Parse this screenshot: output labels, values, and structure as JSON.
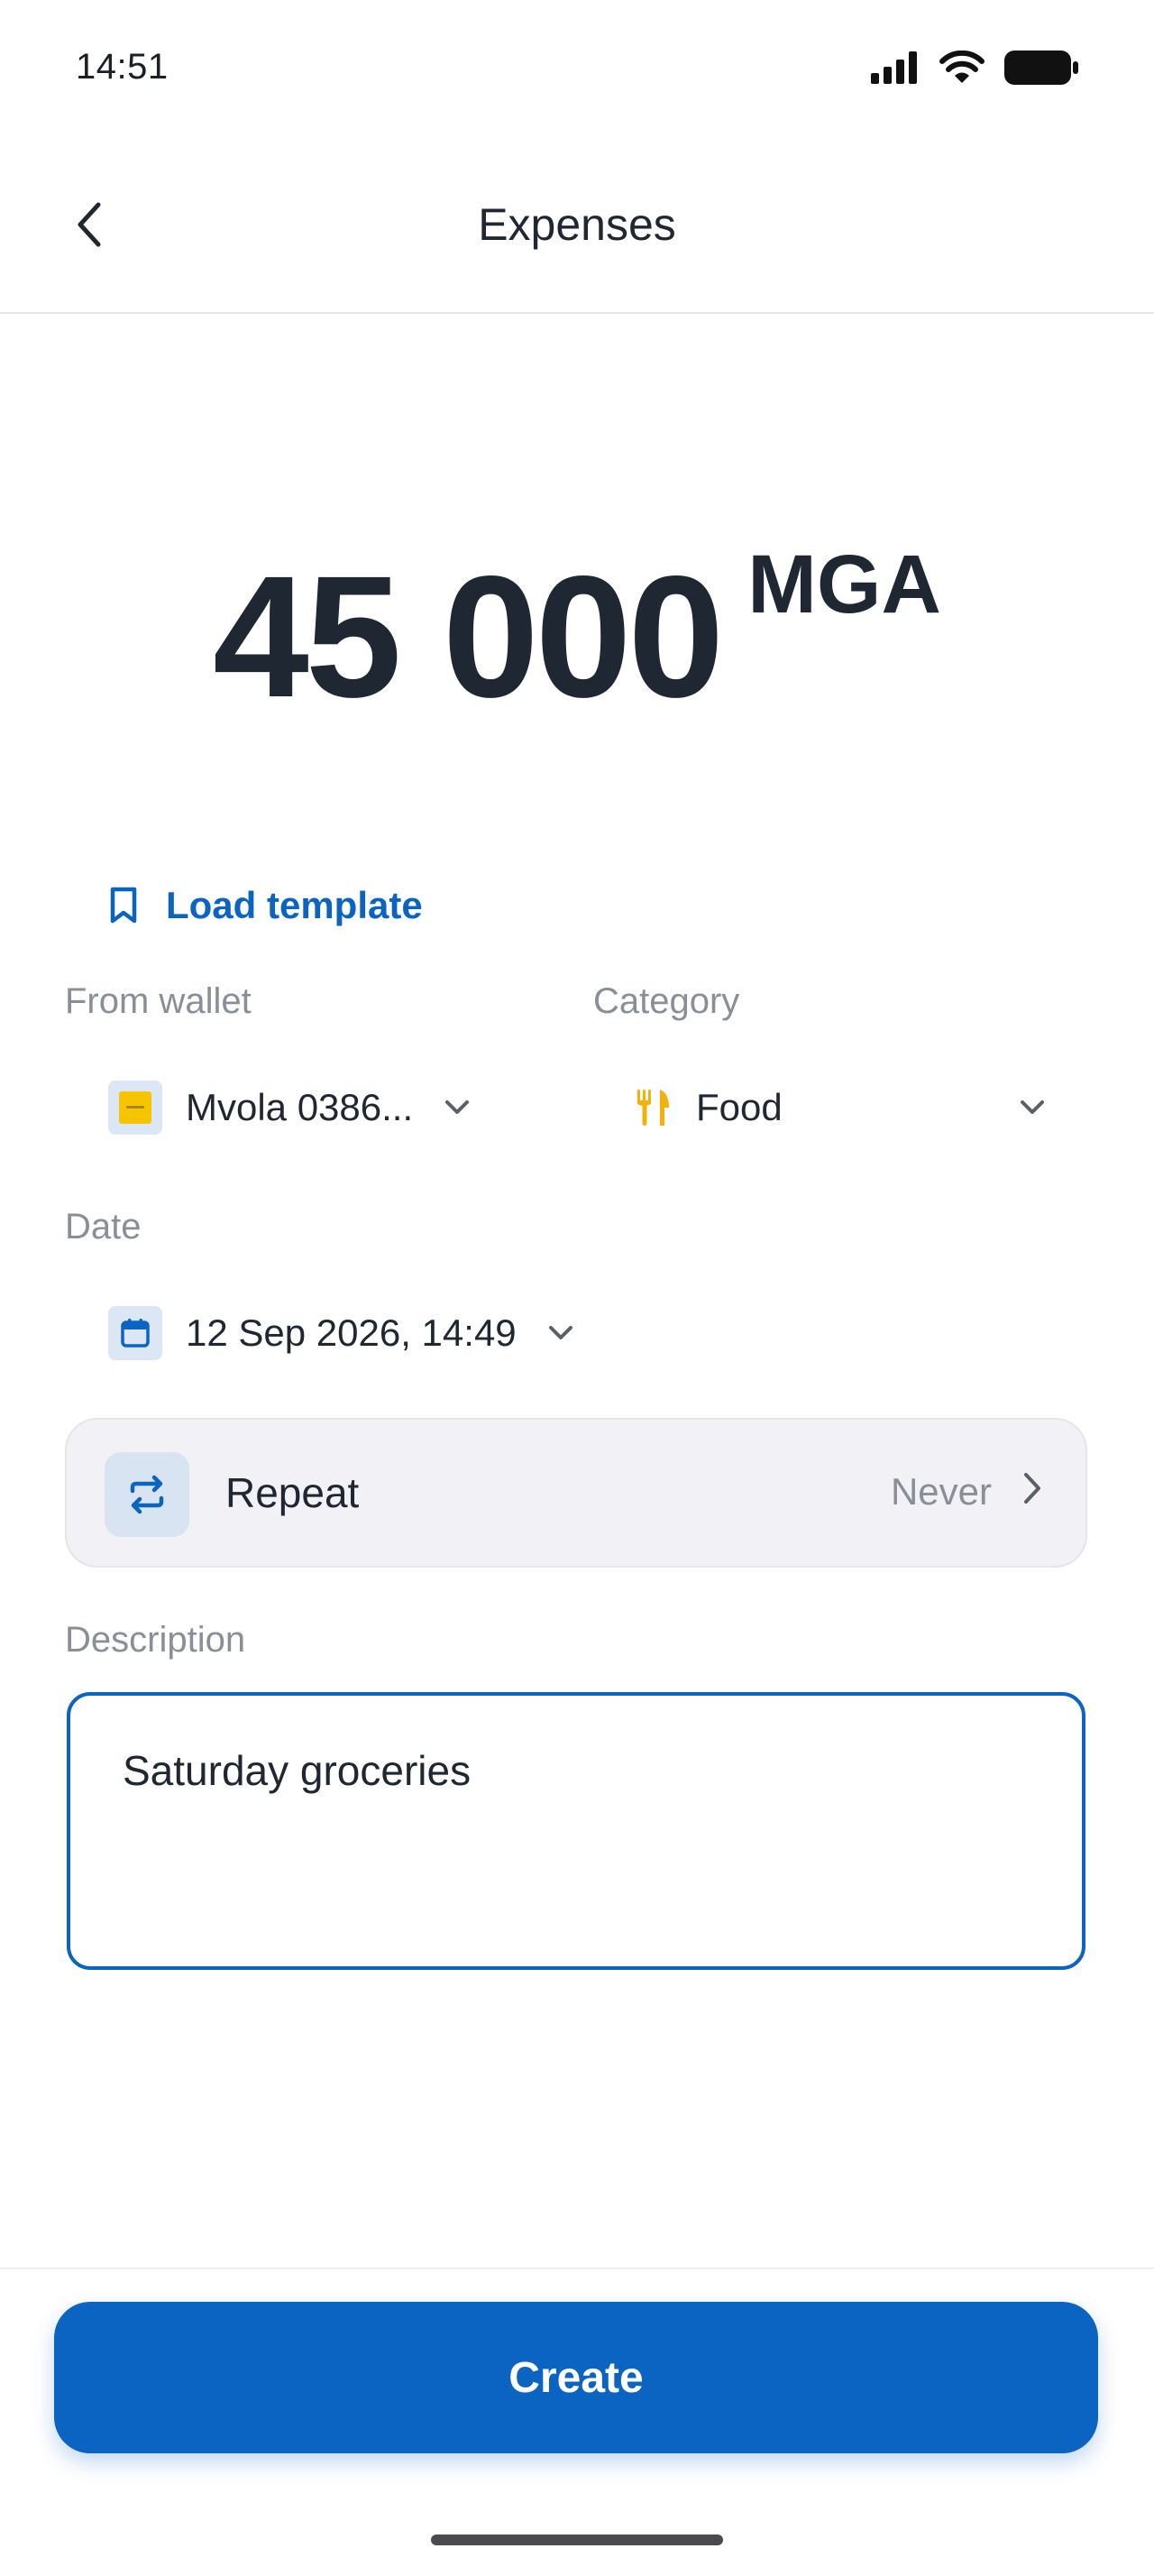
{
  "status_bar": {
    "time": "14:51"
  },
  "header": {
    "title": "Expenses"
  },
  "amount": {
    "value": "45 000",
    "currency": "MGA"
  },
  "load_template": {
    "label": "Load template"
  },
  "wallet": {
    "label": "From wallet",
    "value": "Mvola 0386..."
  },
  "category": {
    "label": "Category",
    "value": "Food"
  },
  "date": {
    "label": "Date",
    "value": "12 Sep 2026, 14:49"
  },
  "repeat": {
    "label": "Repeat",
    "value": "Never"
  },
  "description": {
    "label": "Description",
    "value": "Saturday groceries"
  },
  "create_button": {
    "label": "Create"
  },
  "colors": {
    "accent": "#0b64c2",
    "text": "#1f2733",
    "muted": "#8a8e96",
    "wallet_brand": "#f6c400",
    "category_icon": "#f2b20a"
  },
  "icons": [
    "signal-icon",
    "wifi-icon",
    "battery-icon",
    "back-icon",
    "bookmark-icon",
    "wallet-icon",
    "chevron-down-icon",
    "fork-knife-icon",
    "calendar-icon",
    "repeat-icon",
    "chevron-right-icon"
  ]
}
